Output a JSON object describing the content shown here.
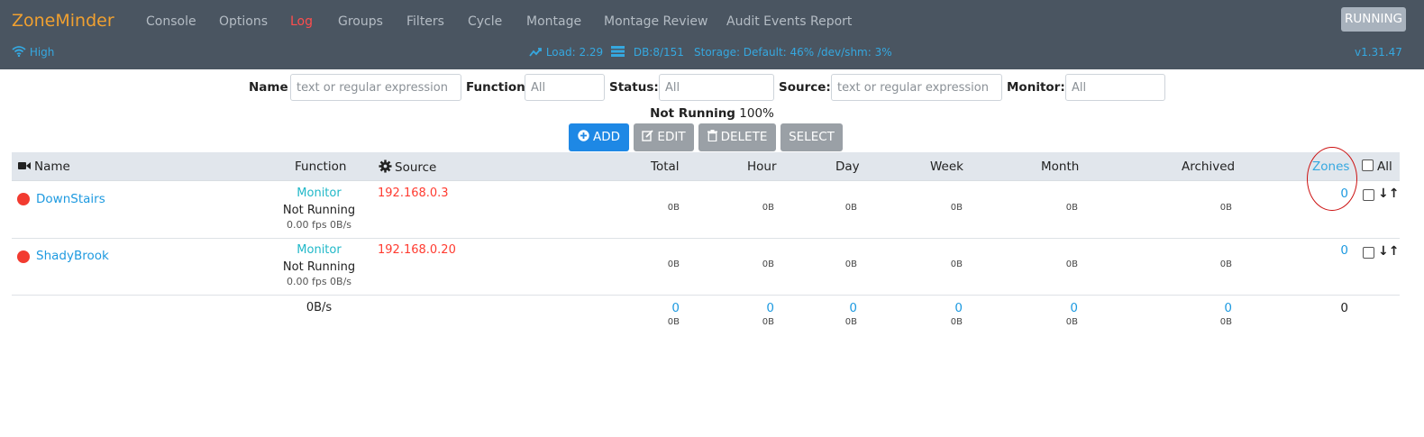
{
  "nav": {
    "brand": "ZoneMinder",
    "links": [
      "Console",
      "Options",
      "Log",
      "Groups",
      "Filters",
      "Cycle",
      "Montage",
      "Montage Review",
      "Audit Events Report"
    ],
    "active_link": "Log",
    "running_label": "RUNNING",
    "bandwidth": "High",
    "load": "Load: 2.29",
    "db": "DB:8/151",
    "storage": "Storage: Default: 46% /dev/shm: 3%",
    "version": "v1.31.47"
  },
  "filters": {
    "name_label": "Name",
    "name_placeholder": "text or regular expression",
    "function_label": "Function",
    "function_placeholder": "All",
    "status_label": "Status:",
    "status_placeholder": "All",
    "source_label": "Source:",
    "source_placeholder": "text or regular expression",
    "monitor_label": "Monitor:",
    "monitor_placeholder": "All"
  },
  "summary": {
    "status": "Not Running",
    "percent": "100%"
  },
  "buttons": {
    "add": "ADD",
    "edit": "EDIT",
    "delete": "DELETE",
    "select": "SELECT"
  },
  "table": {
    "headers": {
      "name": "Name",
      "function": "Function",
      "source": "Source",
      "total": "Total",
      "hour": "Hour",
      "day": "Day",
      "week": "Week",
      "month": "Month",
      "archived": "Archived",
      "zones": "Zones",
      "all": "All"
    },
    "rows": [
      {
        "name": "DownStairs",
        "function": "Monitor",
        "status": "Not Running",
        "fps": "0.00 fps 0B/s",
        "source": "192.168.0.3",
        "total": "0B",
        "hour": "0B",
        "day": "0B",
        "week": "0B",
        "month": "0B",
        "archived": "0B",
        "zones": "0"
      },
      {
        "name": "ShadyBrook",
        "function": "Monitor",
        "status": "Not Running",
        "fps": "0.00 fps 0B/s",
        "source": "192.168.0.20",
        "total": "0B",
        "hour": "0B",
        "day": "0B",
        "week": "0B",
        "month": "0B",
        "archived": "0B",
        "zones": "0"
      }
    ],
    "totals": {
      "bandwidth": "0B/s",
      "total": "0",
      "total_size": "0B",
      "hour": "0",
      "hour_size": "0B",
      "day": "0",
      "day_size": "0B",
      "week": "0",
      "week_size": "0B",
      "month": "0",
      "month_size": "0B",
      "archived": "0",
      "archived_size": "0B",
      "zones": "0"
    }
  },
  "icons": {
    "brand": "zoneminder-logo",
    "wifi": "wifi-icon",
    "load": "trending-up-icon",
    "db": "database-list-icon",
    "camera": "video-camera-icon",
    "gear": "gear-icon",
    "add": "plus-circle-icon",
    "edit": "edit-icon",
    "delete": "trash-icon",
    "sort": "sort-arrows-icon"
  },
  "colors": {
    "navbar": "#4a5561",
    "brand": "#f0a030",
    "active": "#ff4d4d",
    "link": "#1e9ae0",
    "source": "#ff3b30",
    "function": "#20b8c8",
    "status_dot": "#f23b30",
    "annotation": "#cc1111"
  }
}
